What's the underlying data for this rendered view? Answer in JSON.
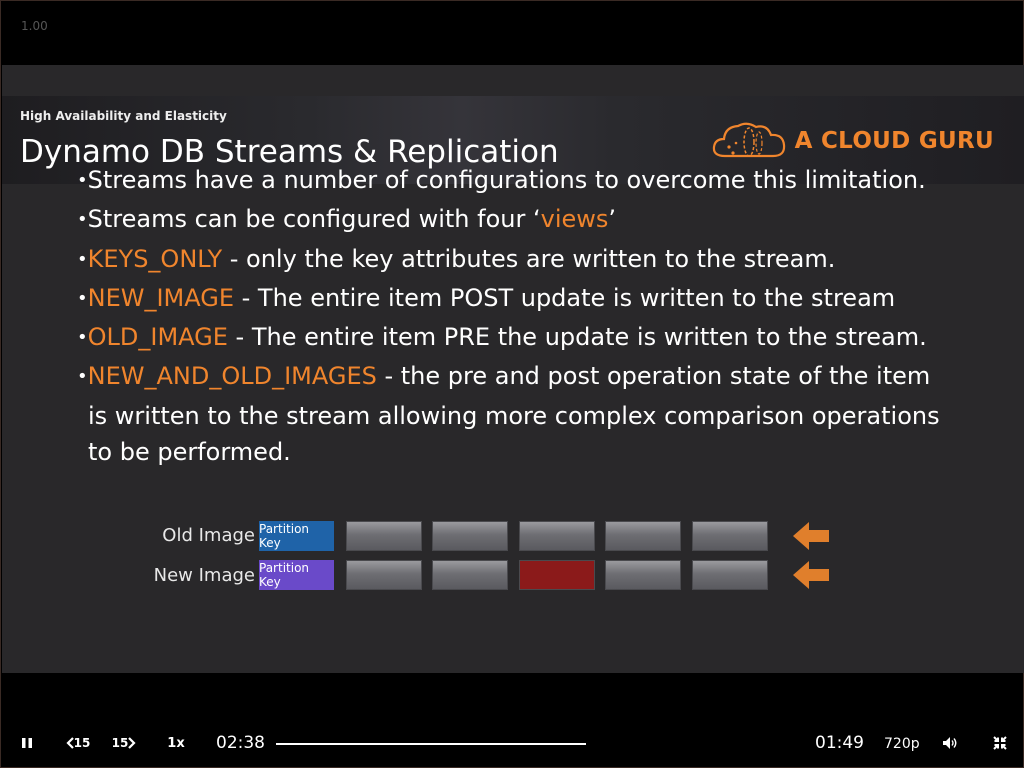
{
  "player": {
    "zoom_indicator": "1.00",
    "elapsed": "02:38",
    "remaining": "01:49",
    "speed": "1x",
    "rewind_label": "15",
    "forward_label": "15",
    "quality": "720p",
    "progress_fraction": 1.0
  },
  "slide": {
    "pretitle": "High Availability and Elasticity",
    "title": "Dynamo DB Streams & Replication",
    "brand": "A CLOUD GURU",
    "accent_color": "#f0852d",
    "bullets": [
      {
        "highlight": "",
        "text": "Streams have a number of configurations to overcome this limitation."
      },
      {
        "lead": "Streams can be configured with four ‘",
        "highlight": "views",
        "tail": "’"
      },
      {
        "highlight": "KEYS_ONLY",
        "text": " - only the key attributes are written to the stream."
      },
      {
        "highlight": "NEW_IMAGE",
        "text": " - The entire item POST update is written to the stream"
      },
      {
        "highlight": "OLD_IMAGE",
        "text": " - The entire item PRE the update is written to the stream."
      },
      {
        "highlight": "NEW_AND_OLD_IMAGES",
        "text": " - the pre and post operation state of the item"
      }
    ],
    "continuation": [
      "is written to the stream allowing more complex comparison operations",
      "to be performed."
    ],
    "diagram": {
      "rows": [
        {
          "label": "Old Image",
          "key_label": "Partition Key",
          "changed_cell_index": -1
        },
        {
          "label": "New Image",
          "key_label": "Partition Key",
          "changed_cell_index": 2
        }
      ]
    }
  }
}
